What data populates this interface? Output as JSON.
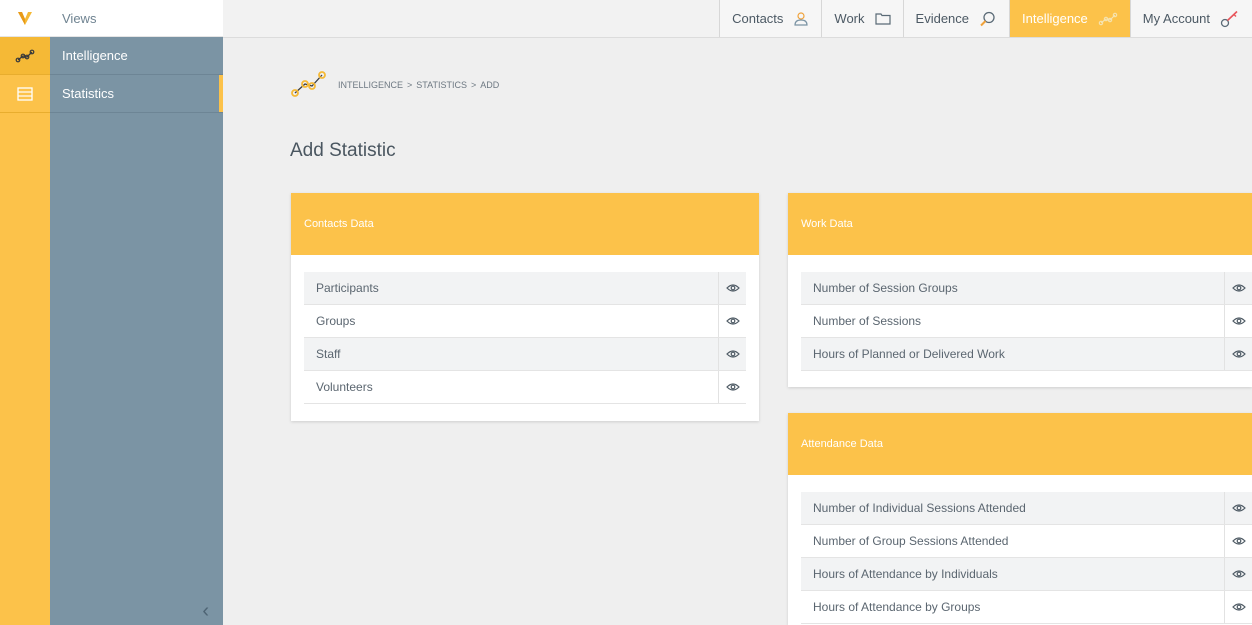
{
  "colors": {
    "accent": "#fcc24a",
    "sidebar": "#7b94a4",
    "text": "#55606a"
  },
  "sidebar": {
    "header": "Views",
    "items": [
      {
        "label": "Intelligence",
        "icon": "intelligence-icon"
      },
      {
        "label": "Statistics",
        "icon": "list-icon"
      }
    ],
    "collapse_icon": "chevron-left-icon"
  },
  "topnav": {
    "tabs": [
      {
        "label": "Contacts",
        "icon": "person-icon"
      },
      {
        "label": "Work",
        "icon": "folder-icon"
      },
      {
        "label": "Evidence",
        "icon": "magnifier-icon"
      },
      {
        "label": "Intelligence",
        "icon": "intelligence-icon",
        "active": true
      },
      {
        "label": "My Account",
        "icon": "key-icon"
      }
    ]
  },
  "breadcrumb": {
    "items": [
      "INTELLIGENCE",
      "STATISTICS",
      "ADD"
    ],
    "separator": ">"
  },
  "page": {
    "title": "Add Statistic"
  },
  "cards": {
    "contacts": {
      "title": "Contacts Data",
      "rows": [
        "Participants",
        "Groups",
        "Staff",
        "Volunteers"
      ]
    },
    "work": {
      "title": "Work Data",
      "rows": [
        "Number of Session Groups",
        "Number of Sessions",
        "Hours of Planned or Delivered Work"
      ]
    },
    "attendance": {
      "title": "Attendance Data",
      "rows": [
        "Number of Individual Sessions Attended",
        "Number of Group Sessions Attended",
        "Hours of Attendance by Individuals",
        "Hours of Attendance by Groups"
      ]
    }
  }
}
